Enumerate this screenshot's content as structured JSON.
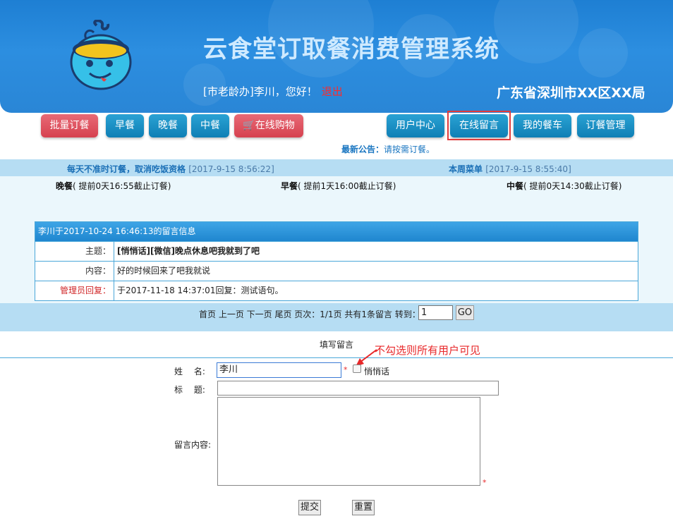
{
  "header": {
    "title": "云食堂订取餐消费管理系统",
    "greeting": "[市老龄办]李川，您好！",
    "logout": "退出",
    "bureau": "广东省深圳市XX区XX局"
  },
  "nav": {
    "batch": "批量订餐",
    "breakfast": "早餐",
    "dinner": "晚餐",
    "lunch": "中餐",
    "shopping": "在线购物",
    "user_center": "用户中心",
    "online_message": "在线留言",
    "my_cart": "我的餐车",
    "order_manage": "订餐管理"
  },
  "notice": {
    "label": "最新公告：",
    "text": "请按需订餐。"
  },
  "strip": {
    "left_title": "每天不准时订餐，取消吃饭资格",
    "left_time": "[2017-9-15 8:56:22]",
    "right_title": "本周菜单",
    "right_time": "[2017-9-15 8:55:40]"
  },
  "meals": [
    {
      "name": "晚餐",
      "desc": "( 提前0天16:55截止订餐)"
    },
    {
      "name": "早餐",
      "desc": "( 提前1天16:00截止订餐)"
    },
    {
      "name": "中餐",
      "desc": "( 提前0天14:30截止订餐)"
    }
  ],
  "message": {
    "header": "李川于2017-10-24 16:46:13的留言信息",
    "subject_label": "主题：",
    "subject": "[悄悄话][微信]晚点休息吧我就到了吧",
    "content_label": "内容：",
    "content": "好的时候回来了吧我就说",
    "reply_label": "管理员回复：",
    "reply": "于2017-11-18 14:37:01回复：测试语句。"
  },
  "pager": {
    "text": "首页 上一页 下一页 尾页 页次：1/1页 共有1条留言 转到：",
    "page_value": "1",
    "go": "GO"
  },
  "form": {
    "title": "填写留言",
    "annotation": "不勾选则所有用户可见",
    "name_label": "姓　 名:",
    "name_value": "李川",
    "private_label": "悄悄话",
    "subject_label": "标　 题:",
    "content_label": "留言内容:",
    "required_mark": "*",
    "submit": "提交",
    "reset": "重置"
  },
  "colors": {
    "banner": "#2a86d6",
    "nav_red": "#d6414f",
    "nav_blue": "#0f7fb5",
    "highlight": "#e23b3b",
    "strip": "#b6ddf3"
  }
}
